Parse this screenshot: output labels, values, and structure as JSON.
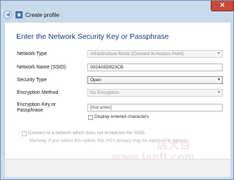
{
  "window": {
    "title": "Create profile",
    "close_glyph": "✕",
    "back_glyph": "◀"
  },
  "heading": "Enter the Network Security Key or Passphrase",
  "fields": {
    "network_type": {
      "label": "Network Type",
      "value": "Infrastructure Mode (Connect to Access Point)"
    },
    "network_name": {
      "label": "Network Name (SSID)",
      "value": "0024A5D923CB"
    },
    "security_type": {
      "label": "Security Type",
      "value": "Open"
    },
    "encryption_method": {
      "label": "Encryption Method",
      "value": "No Encryption"
    },
    "encryption_key": {
      "label_line1": "Encryption Key or",
      "label_line2": "Passphrase",
      "placeholder": "[Not enter]"
    }
  },
  "display_chars": {
    "label": "Display entered characters",
    "checked": false
  },
  "broadcast": {
    "label": "Connect to a network which does not broadcast the SSID.",
    "checked": false,
    "warning": "Warning: If you select this option, this PC's privacy may be exposed to danger."
  },
  "watermark": {
    "line1": "店大百",
    "line2": "www.lapfl.com"
  },
  "icons": {
    "dropdown": "▼"
  }
}
